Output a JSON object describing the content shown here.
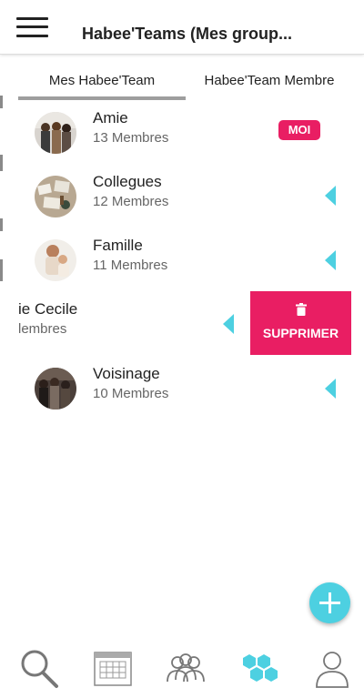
{
  "header": {
    "title": "Habee'Teams (Mes group...",
    "menu_icon": "hamburger-menu-icon"
  },
  "tabs": [
    {
      "label": "Mes Habee'Team",
      "active": true
    },
    {
      "label": "Habee'Team Membre",
      "active": false
    }
  ],
  "groups": [
    {
      "name": "Amie",
      "members": "13 Membres",
      "badge": "MOI",
      "avatar_icon": "group-photo-avatar"
    },
    {
      "name": "Collegues",
      "members": "12 Membres",
      "avatar_icon": "desk-photo-avatar"
    },
    {
      "name": "Famille",
      "members": "11 Membres",
      "avatar_icon": "family-photo-avatar"
    },
    {
      "name": "ie Cecile",
      "members": "lembres",
      "swiped": true
    },
    {
      "name": "Voisinage",
      "members": "10 Membres",
      "avatar_icon": "group-photo-avatar"
    }
  ],
  "delete_action": {
    "label": "SUPPRIMER",
    "icon": "trash-icon"
  },
  "fab": {
    "icon": "plus-icon"
  },
  "bottom_nav": [
    {
      "icon": "search-icon"
    },
    {
      "icon": "calendar-icon"
    },
    {
      "icon": "people-icon"
    },
    {
      "icon": "hexagons-icon",
      "active": true
    },
    {
      "icon": "user-icon"
    }
  ],
  "colors": {
    "accent_cyan": "#4dd0e1",
    "accent_pink": "#e91e63",
    "tab_underline": "#9e9e9e"
  }
}
